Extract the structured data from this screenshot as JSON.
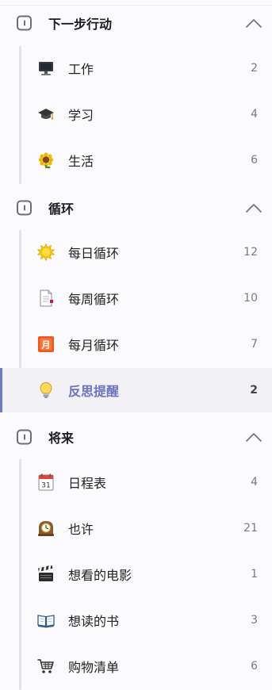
{
  "groups": [
    {
      "title": "下一步行动",
      "items": [
        {
          "label": "工作",
          "count": "2",
          "icon": "computer-icon"
        },
        {
          "label": "学习",
          "count": "4",
          "icon": "graduation-cap-icon"
        },
        {
          "label": "生活",
          "count": "6",
          "icon": "sunflower-icon"
        }
      ]
    },
    {
      "title": "循环",
      "items": [
        {
          "label": "每日循环",
          "count": "12",
          "icon": "sun-icon"
        },
        {
          "label": "每周循环",
          "count": "10",
          "icon": "document-icon"
        },
        {
          "label": "每月循环",
          "count": "7",
          "icon": "calendar-month-icon",
          "icon_text": "月"
        },
        {
          "label": "反思提醒",
          "count": "2",
          "icon": "light-bulb-icon",
          "active": true
        }
      ]
    },
    {
      "title": "将来",
      "items": [
        {
          "label": "日程表",
          "count": "4",
          "icon": "calendar-icon",
          "icon_text": "31"
        },
        {
          "label": "也许",
          "count": "21",
          "icon": "mantel-clock-icon"
        },
        {
          "label": "想看的电影",
          "count": "1",
          "icon": "clapper-board-icon"
        },
        {
          "label": "想读的书",
          "count": "3",
          "icon": "open-book-icon"
        },
        {
          "label": "购物清单",
          "count": "6",
          "icon": "shopping-cart-icon"
        }
      ]
    }
  ],
  "colors": {
    "accent": "#6f79c7",
    "active_background": "#f1f1f6",
    "rail": "#e4e4e8"
  }
}
